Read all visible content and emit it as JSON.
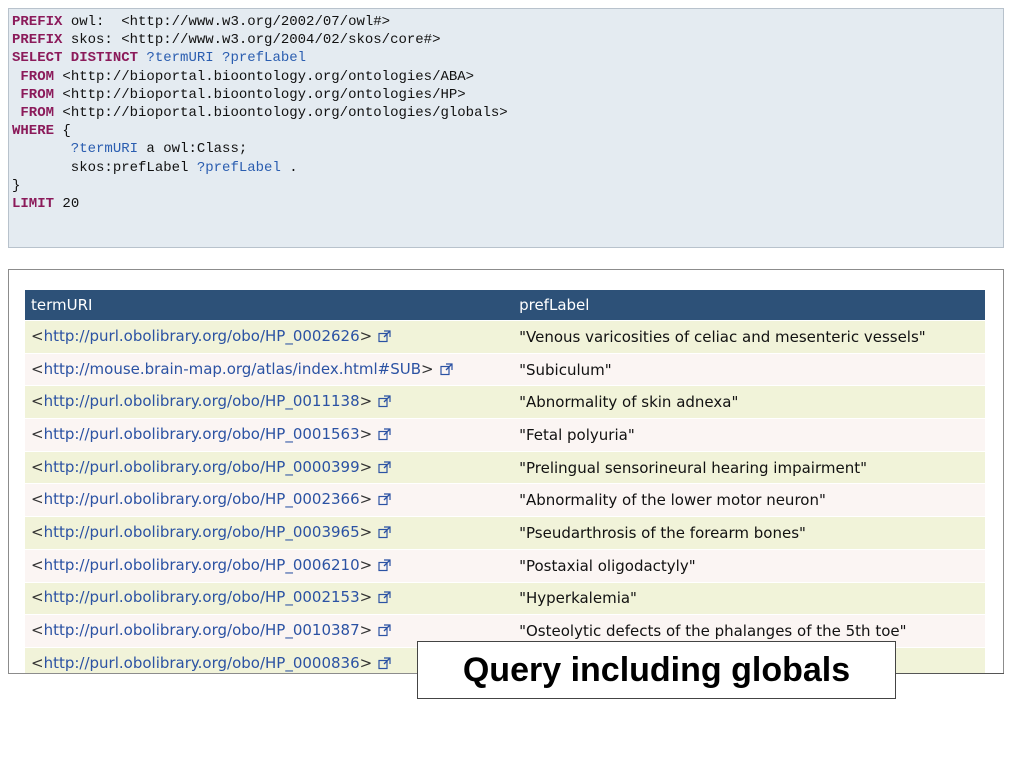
{
  "query": {
    "lines": [
      {
        "k": "PREFIX",
        "t": " owl:  <http://www.w3.org/2002/07/owl#>"
      },
      {
        "k": "PREFIX",
        "t": " skos: <http://www.w3.org/2004/02/skos/core#>"
      },
      {
        "k": "SELECT DISTINCT",
        "v": " ?termURI ?prefLabel"
      },
      {
        "k": " FROM",
        "t": " <http://bioportal.bioontology.org/ontologies/ABA>"
      },
      {
        "k": " FROM",
        "t": " <http://bioportal.bioontology.org/ontologies/HP>"
      },
      {
        "k": " FROM",
        "t": " <http://bioportal.bioontology.org/ontologies/globals>"
      },
      {
        "k": "WHERE",
        "t": " {"
      },
      {
        "v": "       ?termURI",
        "t": " a owl:Class;"
      },
      {
        "t": "       skos:prefLabel ",
        "v": "?prefLabel",
        "t2": " ."
      },
      {
        "t": "}"
      },
      {
        "k": "LIMIT",
        "t": " 20"
      }
    ]
  },
  "results": {
    "headers": {
      "uri": "termURI",
      "label": "prefLabel"
    },
    "rows": [
      {
        "uri": "http://purl.obolibrary.org/obo/HP_0002626",
        "label": "\"Venous varicosities of celiac and mesenteric vessels\""
      },
      {
        "uri": "http://mouse.brain-map.org/atlas/index.html#SUB",
        "label": "\"Subiculum\""
      },
      {
        "uri": "http://purl.obolibrary.org/obo/HP_0011138",
        "label": "\"Abnormality of skin adnexa\""
      },
      {
        "uri": "http://purl.obolibrary.org/obo/HP_0001563",
        "label": "\"Fetal polyuria\""
      },
      {
        "uri": "http://purl.obolibrary.org/obo/HP_0000399",
        "label": "\"Prelingual sensorineural hearing impairment\""
      },
      {
        "uri": "http://purl.obolibrary.org/obo/HP_0002366",
        "label": "\"Abnormality of the lower motor neuron\""
      },
      {
        "uri": "http://purl.obolibrary.org/obo/HP_0003965",
        "label": "\"Pseudarthrosis of the forearm bones\""
      },
      {
        "uri": "http://purl.obolibrary.org/obo/HP_0006210",
        "label": "\"Postaxial oligodactyly\""
      },
      {
        "uri": "http://purl.obolibrary.org/obo/HP_0002153",
        "label": "\"Hyperkalemia\""
      },
      {
        "uri": "http://purl.obolibrary.org/obo/HP_0010387",
        "label": "\"Osteolytic defects of the phalanges of the 5th toe\""
      },
      {
        "uri": "http://purl.obolibrary.org/obo/HP_0000836",
        "label": ""
      }
    ]
  },
  "caption": "Query including globals",
  "icon": "external-link-icon",
  "colors": {
    "header_bg": "#2d5178",
    "keyword": "#8b1a5a",
    "variable": "#2a5db0",
    "link": "#2b52a3",
    "query_bg": "#e4ebf1"
  }
}
